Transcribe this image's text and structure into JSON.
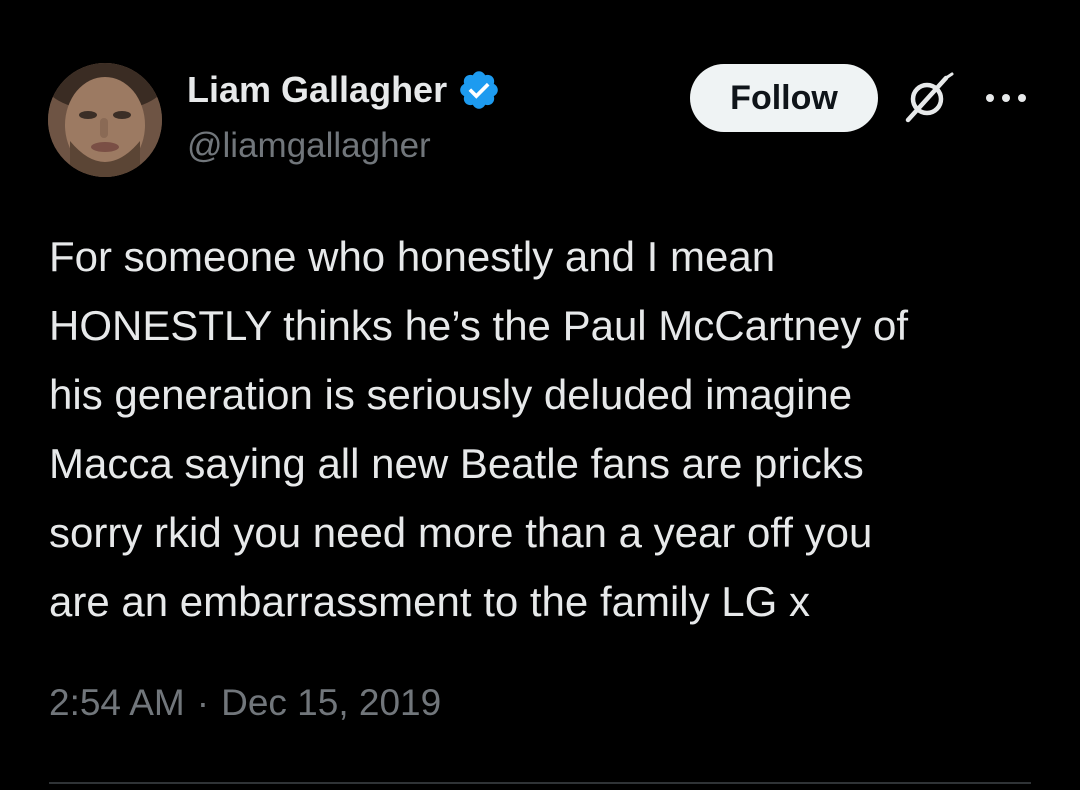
{
  "author": {
    "display_name": "Liam Gallagher",
    "handle": "@liamgallagher",
    "verified": true,
    "avatar_icon": "profile-photo"
  },
  "actions": {
    "follow_label": "Follow",
    "grok_icon": "grok-icon",
    "more_icon": "more-options-icon"
  },
  "tweet": {
    "text": "For someone who honestly and I mean\nHONESTLY thinks he’s the Paul McCartney of\nhis generation is seriously deluded imagine\nMacca saying all new Beatle fans are pricks\nsorry rkid you need more than a year off you\nare an embarrassment to the family LG x",
    "time": "2:54 AM",
    "separator": "·",
    "date": "Dec 15, 2019"
  },
  "colors": {
    "background": "#000000",
    "text_primary": "#e7e9ea",
    "text_secondary": "#71767b",
    "verified_blue": "#1d9bf0",
    "button_bg": "#eff3f4",
    "divider": "#2f3336"
  }
}
